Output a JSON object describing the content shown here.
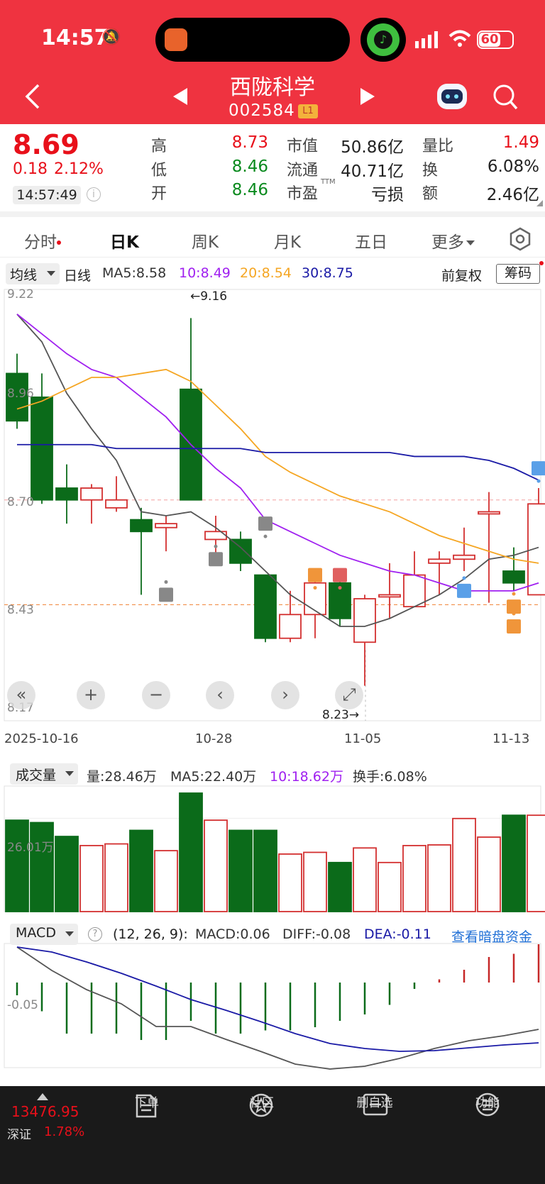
{
  "status_bar": {
    "time": "14:57",
    "battery": "60"
  },
  "header": {
    "title": "西陇科学",
    "code": "002584",
    "level_badge": "L1",
    "back_icon": "chevron-left-icon",
    "prev_icon": "triangle-left-icon",
    "next_icon": "triangle-right-icon",
    "assistant_icon": "robot-icon",
    "search_icon": "search-icon"
  },
  "quote": {
    "price": "8.69",
    "change": "0.18",
    "change_pct": "2.12%",
    "time": "14:57:49",
    "fields": [
      {
        "label": "高",
        "value": "8.73",
        "color": "#e8101a"
      },
      {
        "label": "低",
        "value": "8.46",
        "color": "#0a8a1e"
      },
      {
        "label": "开",
        "value": "8.46",
        "color": "#0a8a1e"
      },
      {
        "label": "市值",
        "value": "50.86亿"
      },
      {
        "label": "流通",
        "value": "40.71亿"
      },
      {
        "label": "市盈",
        "sup": "TTM",
        "value": "亏损"
      },
      {
        "label": "量比",
        "value": "1.49",
        "color": "#e8101a"
      },
      {
        "label": "换",
        "value": "6.08%"
      },
      {
        "label": "额",
        "value": "2.46亿"
      }
    ]
  },
  "tabs": [
    "分时",
    "日K",
    "周K",
    "月K",
    "五日",
    "更多"
  ],
  "active_tab": "日K",
  "kline": {
    "selector": "均线",
    "period": "日线",
    "ma5": "MA5:8.58",
    "ma10": "10:8.49",
    "ma20": "20:8.54",
    "ma30": "30:8.75",
    "adjust": "前复权",
    "chips_button": "筹码",
    "y_ticks": [
      "9.22",
      "8.96",
      "8.70",
      "8.43",
      "8.17"
    ],
    "high_label": "←9.16",
    "low_label": "8.23→",
    "x_labels": [
      "2025-10-16",
      "10-28",
      "11-05",
      "11-13"
    ]
  },
  "volume": {
    "selector": "成交量",
    "vol": "量:28.46万",
    "ma5": "MA5:22.40万",
    "ma10": "10:18.62万",
    "turnover": "换手:6.08%",
    "y_tick": "26.01万"
  },
  "macd": {
    "selector": "MACD",
    "params": "(12, 26, 9):",
    "macd": "MACD:0.06",
    "diff": "DIFF:-0.08",
    "dea": "DEA:-0.11",
    "link": "查看暗盘资金",
    "y_tick": "-0.05"
  },
  "bottom": {
    "index_value": "13476.95",
    "index_name": "深证",
    "index_pct": "1.78%",
    "items": [
      "下单",
      "社区",
      "删自选",
      "功能"
    ]
  },
  "chart_data": {
    "type": "candlestick",
    "dates": [
      "2025-10-16",
      "10-28",
      "11-05",
      "11-13"
    ],
    "candles": [
      [
        9.02,
        8.9,
        9.07,
        8.88
      ],
      [
        8.96,
        8.7,
        9.02,
        8.69
      ],
      [
        8.73,
        8.7,
        8.79,
        8.64
      ],
      [
        8.7,
        8.73,
        8.74,
        8.64
      ],
      [
        8.68,
        8.7,
        8.76,
        8.67
      ],
      [
        8.65,
        8.62,
        8.68,
        8.46
      ],
      [
        8.63,
        8.64,
        8.66,
        8.57
      ],
      [
        8.98,
        8.7,
        9.16,
        8.7
      ],
      [
        8.6,
        8.62,
        8.66,
        8.54
      ],
      [
        8.6,
        8.54,
        8.62,
        8.52
      ],
      [
        8.51,
        8.35,
        8.51,
        8.34
      ],
      [
        8.35,
        8.41,
        8.47,
        8.34
      ],
      [
        8.41,
        8.49,
        8.51,
        8.35
      ],
      [
        8.49,
        8.4,
        8.5,
        8.38
      ],
      [
        8.34,
        8.45,
        8.46,
        8.23
      ],
      [
        8.46,
        8.46,
        8.54,
        8.4
      ],
      [
        8.43,
        8.51,
        8.57,
        8.44
      ],
      [
        8.54,
        8.55,
        8.57,
        8.46
      ],
      [
        8.55,
        8.56,
        8.63,
        8.52
      ],
      [
        8.67,
        8.67,
        8.72,
        8.44
      ],
      [
        8.52,
        8.49,
        8.58,
        8.47
      ],
      [
        8.46,
        8.69,
        8.73,
        8.46
      ]
    ],
    "volume": [
      27.0,
      26.3,
      22.2,
      19.5,
      20.0,
      24.0,
      18.0,
      35.0,
      27.0,
      24.0,
      24.0,
      17.0,
      17.5,
      14.5,
      18.8,
      14.5,
      19.5,
      19.7,
      27.5,
      22.0,
      28.46,
      28.46
    ],
    "macd_hist": [
      -0.02,
      -0.045,
      -0.08,
      -0.08,
      -0.08,
      -0.09,
      -0.09,
      -0.06,
      -0.08,
      -0.08,
      -0.075,
      -0.075,
      -0.07,
      -0.06,
      -0.05,
      -0.035,
      -0.01,
      0.005,
      0.02,
      0.04,
      0.045,
      0.06
    ]
  }
}
